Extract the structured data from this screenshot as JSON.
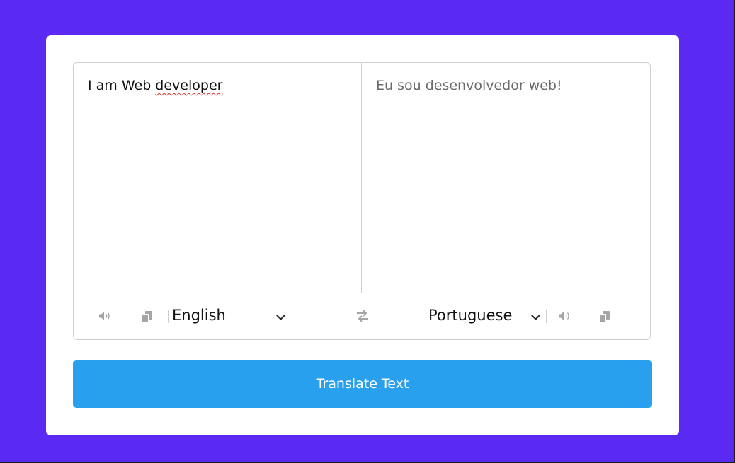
{
  "colors": {
    "background": "#5a2af3",
    "card": "#ffffff",
    "button": "#28a0ee",
    "spellcheck": "#e0322a",
    "icon": "#a5a5a5"
  },
  "source": {
    "text_before": "I am Web ",
    "text_misspelled": "developer",
    "language": "English",
    "icons": [
      "volume-icon",
      "copy-icon"
    ]
  },
  "target": {
    "text": "Eu sou desenvolvedor web!",
    "language": "Portuguese",
    "icons": [
      "volume-icon",
      "copy-icon"
    ]
  },
  "swap": {
    "icon": "swap-arrows-icon"
  },
  "translate_button": {
    "label": "Translate Text"
  }
}
